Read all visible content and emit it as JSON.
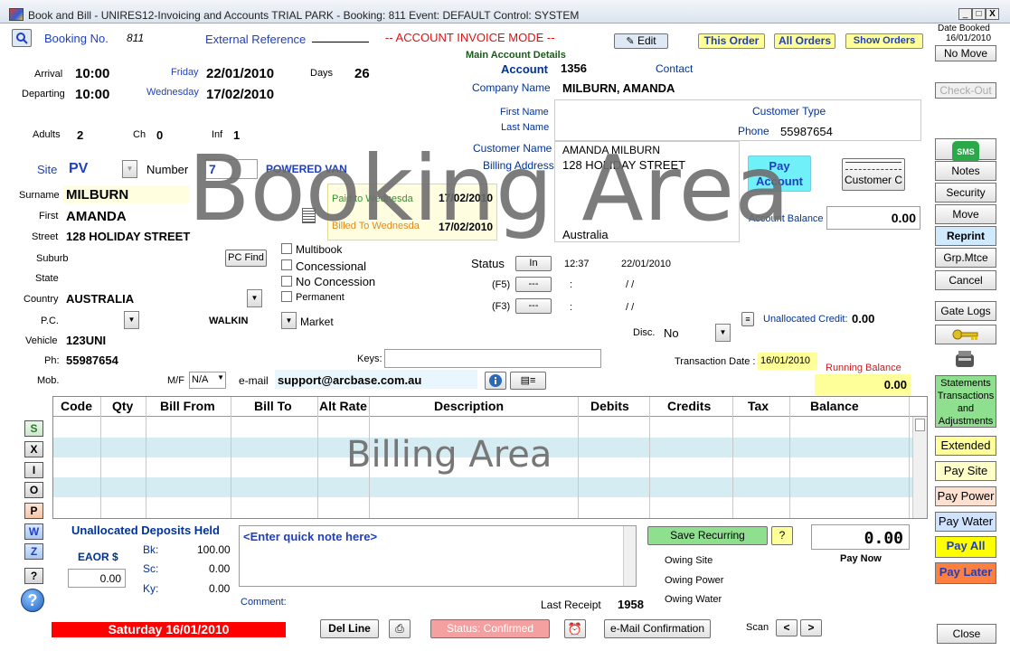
{
  "window": {
    "title": "Book and Bill - UNIRES12-Invoicing and Accounts TRIAL PARK - Booking: 811 Event: DEFAULT Control: SYSTEM",
    "min": "_",
    "max": "□",
    "close": "X"
  },
  "header": {
    "booking_no_label": "Booking No.",
    "booking_no": "811",
    "ext_ref_label": "External Reference",
    "mode": "-- ACCOUNT INVOICE MODE --",
    "edit": "Edit",
    "this_order": "This Order",
    "all_orders": "All Orders",
    "show_orders": "Show Orders",
    "date_booked_label": "Date Booked",
    "date_booked": "16/01/2010",
    "no_move": "No Move",
    "check_out": "Check-Out"
  },
  "stay": {
    "arrival_label": "Arrival",
    "arrival_time": "10:00",
    "arrival_day": "Friday",
    "arrival_date": "22/01/2010",
    "days_label": "Days",
    "days": "26",
    "departing_label": "Departing",
    "departing_time": "10:00",
    "departing_day": "Wednesday",
    "departing_date": "17/02/2010",
    "adults_label": "Adults",
    "adults": "2",
    "ch_label": "Ch",
    "ch": "0",
    "inf_label": "Inf",
    "inf": "1"
  },
  "site": {
    "site_label": "Site",
    "site": "PV",
    "number_label": "Number",
    "number": "7",
    "site_type": "POWERED VAN"
  },
  "customer": {
    "surname_label": "Surname",
    "surname": "MILBURN",
    "first_label": "First",
    "first": "AMANDA",
    "street_label": "Street",
    "street": "128 HOLIDAY STREET",
    "suburb_label": "Suburb",
    "state_label": "State",
    "country_label": "Country",
    "country": "AUSTRALIA",
    "pc_label": "P.C.",
    "walkin": "WALKIN",
    "market": "Market",
    "vehicle_label": "Vehicle",
    "vehicle": "123UNI",
    "ph_label": "Ph:",
    "ph": "55987654",
    "mob_label": "Mob.",
    "mf_label": "M/F",
    "mf": "N/A",
    "email_label": "e-mail",
    "email": "support@arcbase.com.au",
    "keys_label": "Keys:",
    "pc_find": "PC Find"
  },
  "paid": {
    "paid_to": "Paid to Wednesda",
    "paid_to_date": "17/02/2010",
    "billed_to": "Billed To Wednesda",
    "billed_to_date": "17/02/2010"
  },
  "options": {
    "multibook": "Multibook",
    "concessional": "Concessional",
    "no_concession": "No Concession",
    "permanent": "Permanent"
  },
  "account": {
    "section_title": "Main Account Details",
    "account_label": "Account",
    "account": "1356",
    "contact_label": "Contact",
    "company_label": "Company Name",
    "company": "MILBURN, AMANDA",
    "first_name_label": "First Name",
    "last_name_label": "Last Name",
    "customer_type_label": "Customer Type",
    "phone_label": "Phone",
    "phone": "55987654",
    "customer_name_label": "Customer Name",
    "customer_name": "AMANDA MILBURN",
    "billing_address_label": "Billing Address",
    "billing_address": "128 HOLIDAY STREET",
    "billing_country": "Australia",
    "pay_account": "Pay Account",
    "customer_c": "Customer C",
    "account_balance_label": "Account Balance",
    "account_balance": "0.00"
  },
  "status": {
    "status_label": "Status",
    "in": "In",
    "time": "12:37",
    "date": "22/01/2010",
    "f5_label": "(F5)",
    "f3_label": "(F3)",
    "dash": "---",
    "colon": ":",
    "slashes": "/ /",
    "disc_label": "Disc.",
    "disc": "No",
    "unalloc_credit_label": "Unallocated Credit:",
    "unalloc_credit": "0.00",
    "txn_date_label": "Transaction Date :",
    "txn_date": "16/01/2010",
    "running_balance_label": "Running Balance",
    "running_balance": "0.00"
  },
  "sidebar": {
    "sms": "SMS",
    "notes": "Notes",
    "security": "Security",
    "move": "Move",
    "reprint": "Reprint",
    "grp_mtce": "Grp.Mtce",
    "cancel": "Cancel",
    "gate_logs": "Gate Logs",
    "statements": "Statements Transactions and Adjustments",
    "extended": "Extended",
    "pay_site": "Pay Site",
    "pay_power": "Pay Power",
    "pay_water": "Pay Water",
    "pay_all": "Pay All",
    "pay_later": "Pay Later",
    "close": "Close"
  },
  "grid": {
    "headers": [
      "Code",
      "Qty",
      "Bill From",
      "Bill To",
      "Alt Rate",
      "Description",
      "Debits",
      "Credits",
      "Tax",
      "Balance"
    ]
  },
  "left_buttons": [
    "S",
    "X",
    "I",
    "O",
    "P",
    "W",
    "Z",
    "?"
  ],
  "footer": {
    "unalloc_deposits": "Unallocated Deposits Held",
    "eaor_label": "EAOR $",
    "eaor": "0.00",
    "bk_label": "Bk:",
    "bk": "100.00",
    "sc_label": "Sc:",
    "sc": "0.00",
    "ky_label": "Ky:",
    "ky": "0.00",
    "quick_note": "<Enter quick note here>",
    "comment_label": "Comment:",
    "save_recurring": "Save Recurring",
    "question": "?",
    "pay_now_amount": "0.00",
    "pay_now": "Pay Now",
    "owing_site": "Owing Site",
    "owing_power": "Owing Power",
    "owing_water": "Owing Water",
    "last_receipt_label": "Last Receipt",
    "last_receipt": "1958",
    "date_banner": "Saturday 16/01/2010",
    "del_line": "Del Line",
    "status_confirmed": "Status: Confirmed",
    "email_confirmation": "e-Mail Confirmation",
    "scan_label": "Scan",
    "prev": "<",
    "next": ">"
  },
  "overlays": {
    "booking_area": "Booking Area",
    "billing_area": "Billing Area"
  }
}
